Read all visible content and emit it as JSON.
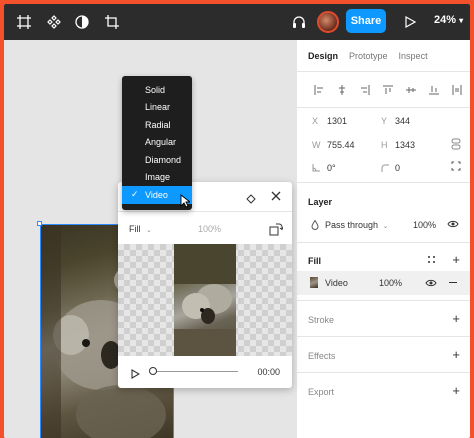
{
  "toolbar": {
    "share_label": "Share",
    "zoom": "24%",
    "icons": [
      "frame-tool-icon",
      "components-icon",
      "contrast-icon",
      "crop-icon",
      "headphones-icon",
      "play-icon",
      "chevron-down-icon"
    ]
  },
  "panel": {
    "tabs": [
      "Design",
      "Prototype",
      "Inspect"
    ],
    "x_label": "X",
    "x_value": "1301",
    "y_label": "Y",
    "y_value": "344",
    "w_label": "W",
    "w_value": "755.44",
    "h_label": "H",
    "h_value": "1343",
    "rotation": "0°",
    "radius": "0",
    "layer": {
      "title": "Layer",
      "blend": "Pass through",
      "opacity": "100%"
    },
    "fill": {
      "title": "Fill",
      "type": "Video",
      "opacity": "100%"
    },
    "stroke_title": "Stroke",
    "effects_title": "Effects",
    "export_title": "Export"
  },
  "dropdown": {
    "items": [
      "Solid",
      "Linear",
      "Radial",
      "Angular",
      "Diamond",
      "Image",
      "Video"
    ],
    "selected": "Video"
  },
  "fill_popup": {
    "mode": "Fill",
    "opacity": "100%",
    "time": "00:00",
    "progress": 0
  },
  "colors": {
    "accent": "#0d99ff",
    "border": "#f2512b",
    "toolbar": "#2c2c2c"
  }
}
